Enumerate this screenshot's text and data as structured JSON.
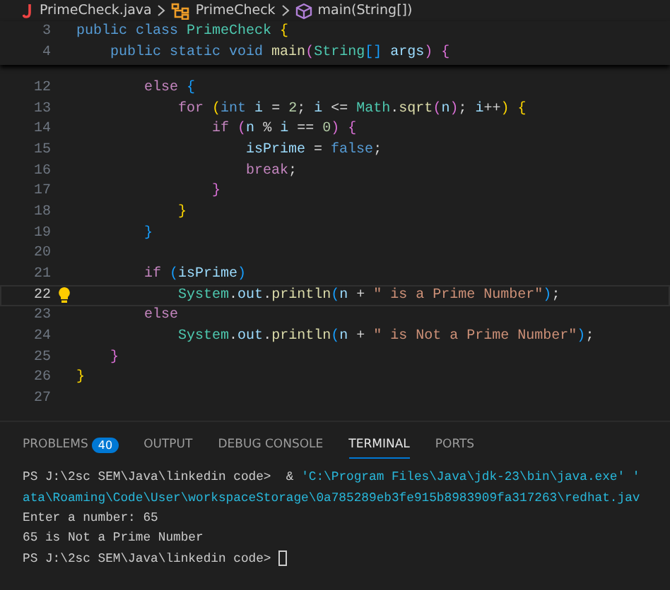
{
  "breadcrumb": [
    {
      "kind": "file",
      "label": "PrimeCheck.java"
    },
    {
      "kind": "class",
      "label": "PrimeCheck"
    },
    {
      "kind": "method",
      "label": "main(String[])"
    }
  ],
  "sticky_lines": [
    {
      "number": "3",
      "active": false,
      "tokens": [
        {
          "kind": "keyword",
          "text": "public"
        },
        {
          "kind": "keyword",
          "text": " class"
        },
        {
          "kind": "type",
          "text": " PrimeCheck"
        },
        {
          "kind": "bracket1",
          "text": " {"
        }
      ]
    },
    {
      "number": "4",
      "active": false,
      "tokens": [
        {
          "kind": "keyword",
          "text": "    public"
        },
        {
          "kind": "keyword",
          "text": " static"
        },
        {
          "kind": "keyword",
          "text": " void"
        },
        {
          "kind": "function",
          "text": " main"
        },
        {
          "kind": "bracket2",
          "text": "("
        },
        {
          "kind": "type",
          "text": "String"
        },
        {
          "kind": "bracket3",
          "text": "[]"
        },
        {
          "kind": "variable",
          "text": " args"
        },
        {
          "kind": "bracket2",
          "text": ")"
        },
        {
          "kind": "bracket2",
          "text": " {"
        }
      ]
    }
  ],
  "lines": [
    {
      "number": "12",
      "active": false,
      "tokens": [
        {
          "kind": "control",
          "text": "        else"
        },
        {
          "kind": "bracket3",
          "text": " {"
        }
      ]
    },
    {
      "number": "13",
      "active": false,
      "tokens": [
        {
          "kind": "control",
          "text": "            for"
        },
        {
          "kind": "bracket1",
          "text": " ("
        },
        {
          "kind": "keyword",
          "text": "int"
        },
        {
          "kind": "variable",
          "text": " i"
        },
        {
          "kind": "plain",
          "text": " = "
        },
        {
          "kind": "number",
          "text": "2"
        },
        {
          "kind": "plain",
          "text": "; "
        },
        {
          "kind": "variable",
          "text": "i"
        },
        {
          "kind": "plain",
          "text": " <= "
        },
        {
          "kind": "type",
          "text": "Math"
        },
        {
          "kind": "plain",
          "text": "."
        },
        {
          "kind": "function",
          "text": "sqrt"
        },
        {
          "kind": "bracket2",
          "text": "("
        },
        {
          "kind": "variable",
          "text": "n"
        },
        {
          "kind": "bracket2",
          "text": ")"
        },
        {
          "kind": "plain",
          "text": "; "
        },
        {
          "kind": "variable",
          "text": "i"
        },
        {
          "kind": "plain",
          "text": "++"
        },
        {
          "kind": "bracket1",
          "text": ")"
        },
        {
          "kind": "bracket1",
          "text": " {"
        }
      ]
    },
    {
      "number": "14",
      "active": false,
      "tokens": [
        {
          "kind": "control",
          "text": "                if"
        },
        {
          "kind": "bracket2",
          "text": " ("
        },
        {
          "kind": "variable",
          "text": "n"
        },
        {
          "kind": "plain",
          "text": " % "
        },
        {
          "kind": "variable",
          "text": "i"
        },
        {
          "kind": "plain",
          "text": " == "
        },
        {
          "kind": "number",
          "text": "0"
        },
        {
          "kind": "bracket2",
          "text": ")"
        },
        {
          "kind": "bracket2",
          "text": " {"
        }
      ]
    },
    {
      "number": "15",
      "active": false,
      "tokens": [
        {
          "kind": "variable",
          "text": "                    isPrime"
        },
        {
          "kind": "plain",
          "text": " = "
        },
        {
          "kind": "keyword",
          "text": "false"
        },
        {
          "kind": "plain",
          "text": ";"
        }
      ]
    },
    {
      "number": "16",
      "active": false,
      "tokens": [
        {
          "kind": "control",
          "text": "                    break"
        },
        {
          "kind": "plain",
          "text": ";"
        }
      ]
    },
    {
      "number": "17",
      "active": false,
      "tokens": [
        {
          "kind": "bracket2",
          "text": "                }"
        }
      ]
    },
    {
      "number": "18",
      "active": false,
      "tokens": [
        {
          "kind": "bracket1",
          "text": "            }"
        }
      ]
    },
    {
      "number": "19",
      "active": false,
      "tokens": [
        {
          "kind": "bracket3",
          "text": "        }"
        }
      ]
    },
    {
      "number": "20",
      "active": false
    },
    {
      "number": "21",
      "active": false,
      "tokens": [
        {
          "kind": "control",
          "text": "        if"
        },
        {
          "kind": "bracket3",
          "text": " ("
        },
        {
          "kind": "variable",
          "text": "isPrime"
        },
        {
          "kind": "bracket3",
          "text": ")"
        }
      ]
    },
    {
      "number": "22",
      "active": true,
      "tokens": [
        {
          "kind": "type",
          "text": "            System"
        },
        {
          "kind": "plain",
          "text": "."
        },
        {
          "kind": "variable",
          "text": "out"
        },
        {
          "kind": "plain",
          "text": "."
        },
        {
          "kind": "function",
          "text": "println"
        },
        {
          "kind": "bracket3",
          "text": "("
        },
        {
          "kind": "variable",
          "text": "n"
        },
        {
          "kind": "plain",
          "text": " + "
        },
        {
          "kind": "string",
          "text": "\" is a Prime Number\""
        },
        {
          "kind": "bracket3",
          "text": ")"
        },
        {
          "kind": "plain",
          "text": ";"
        }
      ]
    },
    {
      "number": "23",
      "active": false,
      "tokens": [
        {
          "kind": "control",
          "text": "        else"
        }
      ]
    },
    {
      "number": "24",
      "active": false,
      "tokens": [
        {
          "kind": "type",
          "text": "            System"
        },
        {
          "kind": "plain",
          "text": "."
        },
        {
          "kind": "variable",
          "text": "out"
        },
        {
          "kind": "plain",
          "text": "."
        },
        {
          "kind": "function",
          "text": "println"
        },
        {
          "kind": "bracket3",
          "text": "("
        },
        {
          "kind": "variable",
          "text": "n"
        },
        {
          "kind": "plain",
          "text": " + "
        },
        {
          "kind": "string",
          "text": "\" is Not a Prime Number\""
        },
        {
          "kind": "bracket3",
          "text": ")"
        },
        {
          "kind": "plain",
          "text": ";"
        }
      ]
    },
    {
      "number": "25",
      "active": false,
      "tokens": [
        {
          "kind": "bracket2",
          "text": "    }"
        }
      ]
    },
    {
      "number": "26",
      "active": false,
      "tokens": [
        {
          "kind": "bracket1",
          "text": "}"
        }
      ]
    },
    {
      "number": "27",
      "active": false
    }
  ],
  "panel_tabs": [
    {
      "label": "PROBLEMS",
      "badge": "40",
      "selected": false
    },
    {
      "label": "OUTPUT",
      "selected": false
    },
    {
      "label": "DEBUG CONSOLE",
      "selected": false
    },
    {
      "label": "TERMINAL",
      "selected": true
    },
    {
      "label": "PORTS",
      "selected": false
    }
  ],
  "terminal_lines": [
    [
      {
        "kind": "plain",
        "text": "PS J:\\2sc SEM\\Java\\linkedin code>  & "
      },
      {
        "kind": "path",
        "text": "'C:\\Program Files\\Java\\jdk-23\\bin\\java.exe' '"
      }
    ],
    [
      {
        "kind": "path",
        "text": "ata\\Roaming\\Code\\User\\workspaceStorage\\0a785289eb3fe915b8983909fa317263\\redhat.jav"
      }
    ],
    [
      {
        "kind": "plain",
        "text": "Enter a number: 65"
      }
    ],
    [
      {
        "kind": "plain",
        "text": "65 is Not a Prime Number"
      }
    ],
    [
      {
        "kind": "plain",
        "text": "PS J:\\2sc SEM\\Java\\linkedin code> "
      },
      {
        "kind": "cursor"
      }
    ]
  ]
}
